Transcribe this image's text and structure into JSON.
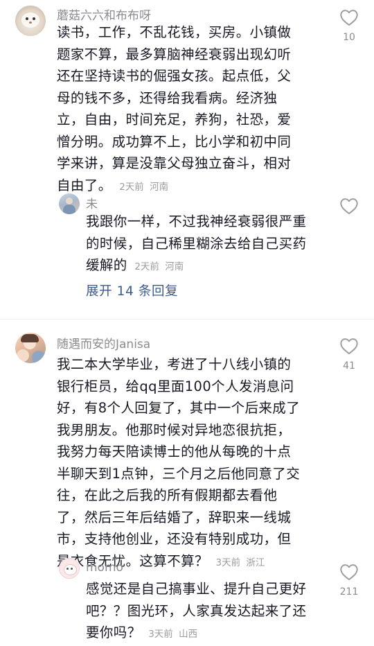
{
  "comments": [
    {
      "user": "蘑菇六六和布布呀",
      "lines": [
        "读书，工作，不乱花钱，买房。小镇做",
        "题家不算，最多算脑神经衰弱出现幻听",
        "还在坚持读书的倔强女孩。起点低，父",
        "母的钱不多，还得给我看病。经济独",
        "立，自由，时间充足，养狗，社恐，爱",
        "憎分明。成功算不上，比小学和初中同",
        "学来讲，算是没靠父母独立奋斗，相对",
        "自由了。"
      ],
      "time": "2天前",
      "location": "河南",
      "likes": "10",
      "reply": {
        "user": "未",
        "lines": [
          "我跟你一样，不过我神经衰弱很严重",
          "的时候，自己稀里糊涂去给自己买药",
          "缓解的"
        ],
        "time": "2天前",
        "location": "河南",
        "likes": ""
      },
      "expand_label": "展开 14 条回复"
    },
    {
      "user": "随遇而安的Janisa",
      "lines": [
        "我二本大学毕业，考进了十八线小镇的",
        "银行柜员，给qq里面100个人发消息问",
        "好，有8个人回复了，其中一个后来成了",
        "我男朋友。他那时候对异地恋很抗拒，",
        "我努力每天陪读博士的他从每晚的十点",
        "半聊天到1点钟，三个月之后他同意了交",
        "往，在此之后我的所有假期都去看他",
        "了，然后三年后结婚了，辞职来一线城",
        "市，支持他创业，还没有特别成功，但",
        "是衣食无忧。这算不算？"
      ],
      "time": "3天前",
      "location": "浙江",
      "likes": "41",
      "reply": {
        "user": "momo",
        "lines": [
          "感觉还是自己搞事业、提升自己更好",
          "吧？？图光环，人家真发达起来了还",
          "要你吗？"
        ],
        "time": "3天前",
        "location": "山西",
        "likes": "211"
      }
    }
  ],
  "colors": {
    "text": "#161823",
    "meta": "#9b9ca1",
    "link": "#3d5a8c"
  },
  "icons": {
    "like": "heart-outline-icon"
  }
}
